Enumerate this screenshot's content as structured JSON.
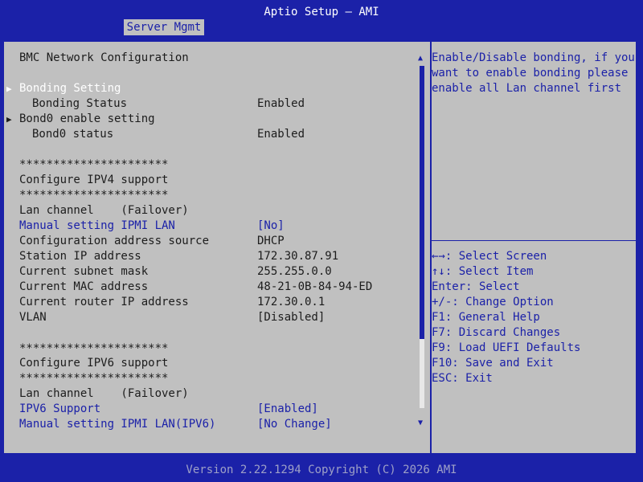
{
  "app_title": "Aptio Setup – AMI",
  "tabs": [
    {
      "label": "Server Mgmt",
      "active": true
    }
  ],
  "section_title": "BMC Network Configuration",
  "settings": {
    "bonding_setting": {
      "label": "Bonding Setting"
    },
    "bonding_status": {
      "label": "Bonding Status",
      "value": "Enabled"
    },
    "bond0_enable_setting": {
      "label": "Bond0 enable setting"
    },
    "bond0_status": {
      "label": "Bond0 status",
      "value": "Enabled"
    },
    "ipv4_separator_top": "**********************",
    "ipv4_header": "Configure IPV4 support",
    "ipv4_separator_bottom": "**********************",
    "ipv4_lan_channel": "Lan channel    (Failover)",
    "manual_setting_ipmi_lan": {
      "label": "Manual setting IPMI LAN",
      "value": "[No]"
    },
    "configuration_address_source": {
      "label": "Configuration address source",
      "value": "DHCP"
    },
    "station_ip_address": {
      "label": "Station IP address",
      "value": "172.30.87.91"
    },
    "current_subnet_mask": {
      "label": "Current subnet mask",
      "value": "255.255.0.0"
    },
    "current_mac_address": {
      "label": "Current MAC address",
      "value": "48-21-0B-84-94-ED"
    },
    "current_router_ip_address": {
      "label": "Current router IP address",
      "value": "172.30.0.1"
    },
    "vlan": {
      "label": "VLAN",
      "value": "[Disabled]"
    },
    "ipv6_separator_top": "**********************",
    "ipv6_header": "Configure IPV6 support",
    "ipv6_separator_bottom": "**********************",
    "ipv6_lan_channel": "Lan channel    (Failover)",
    "ipv6_support": {
      "label": "IPV6 Support",
      "value": "[Enabled]"
    },
    "manual_setting_ipmi_lan_ipv6": {
      "label": "Manual setting IPMI LAN(IPV6)",
      "value": "[No Change]"
    }
  },
  "help_text": "Enable/Disable bonding, if you\nwant to enable bonding please\nenable all Lan channel first",
  "key_help": {
    "select_screen": "←→: Select Screen",
    "select_item": "↑↓: Select Item",
    "enter_select": "Enter: Select",
    "change_option": "+/-: Change Option",
    "general_help": "F1: General Help",
    "discard_changes": "F7: Discard Changes",
    "load_defaults": "F9: Load UEFI Defaults",
    "save_exit": "F10: Save and Exit",
    "esc_exit": "ESC: Exit"
  },
  "scrollbar": {
    "position_fraction": 0
  },
  "footer": "Version 2.22.1294 Copyright (C) 2026 AMI",
  "colors": {
    "frame_blue": "#1b21a8",
    "panel_gray": "#c0c0c0",
    "text_dark": "#1c1c1c",
    "highlight_white": "#ffffff",
    "footer_text": "#9ea0c7"
  },
  "icons": {
    "submenu_indicator": "right-triangle-icon",
    "scroll_up": "scroll-up-arrow-icon",
    "scroll_down": "scroll-down-arrow-icon"
  }
}
